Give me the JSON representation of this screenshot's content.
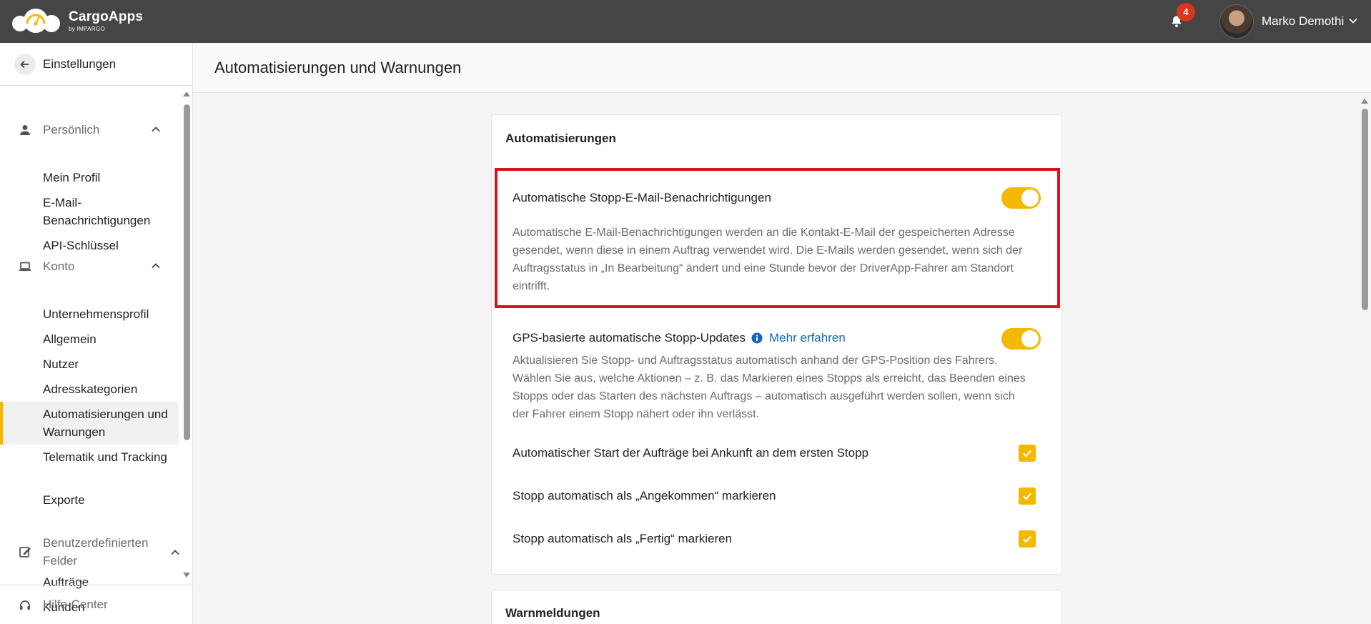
{
  "app": {
    "name": "CargoApps",
    "by": "by IMPARGO",
    "notifications_count": "4",
    "user_name": "Marko Demothi"
  },
  "sidebar": {
    "back_label": "Einstellungen",
    "groups": [
      {
        "label": "Persönlich",
        "icon": "person-icon",
        "items": [
          "Mein Profil",
          "E-Mail-Benachrichtigungen",
          "API-Schlüssel"
        ]
      },
      {
        "label": "Konto",
        "icon": "laptop-icon",
        "items": [
          "Unternehmensprofil",
          "Allgemein",
          "Nutzer",
          "Adresskategorien",
          "Automatisierungen und Warnungen",
          "Telematik und Tracking",
          "Exporte"
        ]
      },
      {
        "label": "Benutzerdefinierten Felder",
        "icon": "edit-icon",
        "items": [
          "Aufträge",
          "Kunden"
        ]
      }
    ],
    "active_item": "Automatisierungen und Warnungen",
    "help_label": "Hilfe-Center"
  },
  "page": {
    "title": "Automatisierungen und Warnungen"
  },
  "automations": {
    "title": "Automatisierungen",
    "email_stop": {
      "title": "Automatische Stopp-E-Mail-Benachrichtigungen",
      "enabled": true,
      "description": "Automatische E-Mail-Benachrichtigungen werden an die Kontakt-E-Mail der gespeicherten Adresse gesendet, wenn diese in einem Auftrag verwendet wird. Die E-Mails werden gesendet, wenn sich der Auftragsstatus in „In Bearbeitung“ ändert und eine Stunde bevor der DriverApp-Fahrer am Standort eintrifft."
    },
    "gps_stop": {
      "title": "GPS-basierte automatische Stopp-Updates",
      "link": "Mehr erfahren",
      "enabled": true,
      "description": "Aktualisieren Sie Stopp- und Auftragsstatus automatisch anhand der GPS-Position des Fahrers. Wählen Sie aus, welche Aktionen – z. B. das Markieren eines Stopps als erreicht, das Beenden eines Stopps oder das Starten des nächsten Auftrags – automatisch ausgeführt werden sollen, wenn sich der Fahrer einem Stopp nähert oder ihn verlässt."
    },
    "options": [
      {
        "label": "Automatischer Start der Aufträge bei Ankunft an dem ersten Stopp",
        "checked": true
      },
      {
        "label": "Stopp automatisch als „Angekommen“ markieren",
        "checked": true
      },
      {
        "label": "Stopp automatisch als „Fertig“ markieren",
        "checked": true
      }
    ]
  },
  "warnings": {
    "title": "Warnmeldungen"
  },
  "colors": {
    "accent": "#f5b800",
    "topbar": "#454545",
    "highlight_border": "#d9141b",
    "link": "#1565c0",
    "badge": "#d9381e"
  }
}
